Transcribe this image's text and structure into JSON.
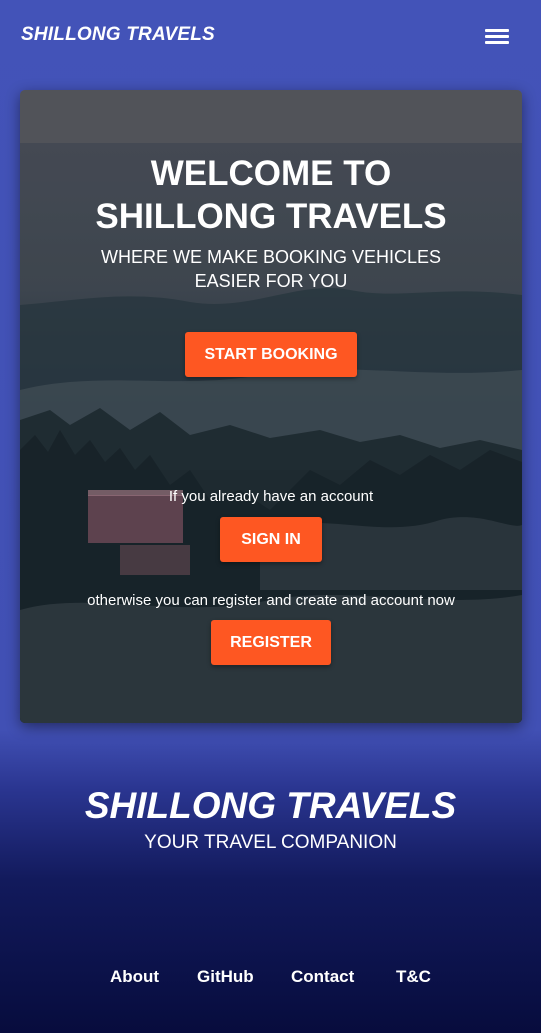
{
  "navbar": {
    "brand": "SHILLONG TRAVELS",
    "menu_icon": "hamburger-menu-icon"
  },
  "hero": {
    "title_line1": "WELCOME TO",
    "title_line2": "SHILLONG TRAVELS",
    "subtitle_line1": "WHERE WE MAKE BOOKING VEHICLES",
    "subtitle_line2": "EASIER FOR YOU",
    "start_booking_label": "START BOOKING",
    "signin_note": "If you already have an account",
    "signin_label": "SIGN IN",
    "register_note": "otherwise you can register and create and account now",
    "register_label": "REGISTER"
  },
  "footer": {
    "title": "SHILLONG TRAVELS",
    "tagline": "YOUR TRAVEL COMPANION",
    "links": [
      {
        "label": "About"
      },
      {
        "label": "GitHub"
      },
      {
        "label": "Contact"
      },
      {
        "label": "T&C"
      }
    ]
  },
  "colors": {
    "accent": "#fe5722",
    "primary": "#4353b8",
    "footer_dark": "#070c3d"
  }
}
